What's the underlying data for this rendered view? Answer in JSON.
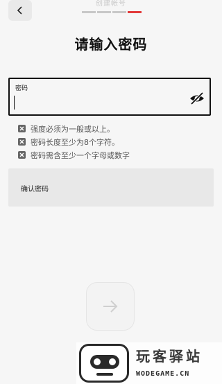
{
  "header": {
    "step_title": "创建帐号",
    "progress": {
      "total": 4,
      "current": 4
    }
  },
  "page": {
    "heading": "请输入密码"
  },
  "password": {
    "label": "密码",
    "value": "",
    "placeholder": ""
  },
  "rules": [
    {
      "text": "强度必须为一般或以上。"
    },
    {
      "text": "密码长度至少为8个字符。"
    },
    {
      "text": "密码需含至少一个字母或数字"
    }
  ],
  "confirm": {
    "label": "确认密码"
  },
  "watermark": {
    "cn": "玩客驿站",
    "en": "WODEGAME.CN"
  },
  "colors": {
    "accent": "#e23a3a",
    "background": "#f6f6f6"
  },
  "icons": {
    "back": "chevron-left-icon",
    "eye": "eye-off-icon",
    "rule": "x-box-icon",
    "next": "arrow-right-icon"
  }
}
